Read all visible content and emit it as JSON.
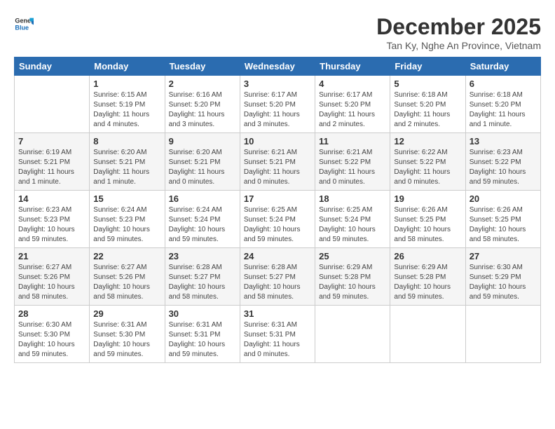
{
  "logo": {
    "line1": "General",
    "line2": "Blue"
  },
  "title": "December 2025",
  "subtitle": "Tan Ky, Nghe An Province, Vietnam",
  "weekdays": [
    "Sunday",
    "Monday",
    "Tuesday",
    "Wednesday",
    "Thursday",
    "Friday",
    "Saturday"
  ],
  "weeks": [
    [
      {
        "day": "",
        "info": ""
      },
      {
        "day": "1",
        "info": "Sunrise: 6:15 AM\nSunset: 5:19 PM\nDaylight: 11 hours\nand 4 minutes."
      },
      {
        "day": "2",
        "info": "Sunrise: 6:16 AM\nSunset: 5:20 PM\nDaylight: 11 hours\nand 3 minutes."
      },
      {
        "day": "3",
        "info": "Sunrise: 6:17 AM\nSunset: 5:20 PM\nDaylight: 11 hours\nand 3 minutes."
      },
      {
        "day": "4",
        "info": "Sunrise: 6:17 AM\nSunset: 5:20 PM\nDaylight: 11 hours\nand 2 minutes."
      },
      {
        "day": "5",
        "info": "Sunrise: 6:18 AM\nSunset: 5:20 PM\nDaylight: 11 hours\nand 2 minutes."
      },
      {
        "day": "6",
        "info": "Sunrise: 6:18 AM\nSunset: 5:20 PM\nDaylight: 11 hours\nand 1 minute."
      }
    ],
    [
      {
        "day": "7",
        "info": "Sunrise: 6:19 AM\nSunset: 5:21 PM\nDaylight: 11 hours\nand 1 minute."
      },
      {
        "day": "8",
        "info": "Sunrise: 6:20 AM\nSunset: 5:21 PM\nDaylight: 11 hours\nand 1 minute."
      },
      {
        "day": "9",
        "info": "Sunrise: 6:20 AM\nSunset: 5:21 PM\nDaylight: 11 hours\nand 0 minutes."
      },
      {
        "day": "10",
        "info": "Sunrise: 6:21 AM\nSunset: 5:21 PM\nDaylight: 11 hours\nand 0 minutes."
      },
      {
        "day": "11",
        "info": "Sunrise: 6:21 AM\nSunset: 5:22 PM\nDaylight: 11 hours\nand 0 minutes."
      },
      {
        "day": "12",
        "info": "Sunrise: 6:22 AM\nSunset: 5:22 PM\nDaylight: 11 hours\nand 0 minutes."
      },
      {
        "day": "13",
        "info": "Sunrise: 6:23 AM\nSunset: 5:22 PM\nDaylight: 10 hours\nand 59 minutes."
      }
    ],
    [
      {
        "day": "14",
        "info": "Sunrise: 6:23 AM\nSunset: 5:23 PM\nDaylight: 10 hours\nand 59 minutes."
      },
      {
        "day": "15",
        "info": "Sunrise: 6:24 AM\nSunset: 5:23 PM\nDaylight: 10 hours\nand 59 minutes."
      },
      {
        "day": "16",
        "info": "Sunrise: 6:24 AM\nSunset: 5:24 PM\nDaylight: 10 hours\nand 59 minutes."
      },
      {
        "day": "17",
        "info": "Sunrise: 6:25 AM\nSunset: 5:24 PM\nDaylight: 10 hours\nand 59 minutes."
      },
      {
        "day": "18",
        "info": "Sunrise: 6:25 AM\nSunset: 5:24 PM\nDaylight: 10 hours\nand 59 minutes."
      },
      {
        "day": "19",
        "info": "Sunrise: 6:26 AM\nSunset: 5:25 PM\nDaylight: 10 hours\nand 58 minutes."
      },
      {
        "day": "20",
        "info": "Sunrise: 6:26 AM\nSunset: 5:25 PM\nDaylight: 10 hours\nand 58 minutes."
      }
    ],
    [
      {
        "day": "21",
        "info": "Sunrise: 6:27 AM\nSunset: 5:26 PM\nDaylight: 10 hours\nand 58 minutes."
      },
      {
        "day": "22",
        "info": "Sunrise: 6:27 AM\nSunset: 5:26 PM\nDaylight: 10 hours\nand 58 minutes."
      },
      {
        "day": "23",
        "info": "Sunrise: 6:28 AM\nSunset: 5:27 PM\nDaylight: 10 hours\nand 58 minutes."
      },
      {
        "day": "24",
        "info": "Sunrise: 6:28 AM\nSunset: 5:27 PM\nDaylight: 10 hours\nand 58 minutes."
      },
      {
        "day": "25",
        "info": "Sunrise: 6:29 AM\nSunset: 5:28 PM\nDaylight: 10 hours\nand 59 minutes."
      },
      {
        "day": "26",
        "info": "Sunrise: 6:29 AM\nSunset: 5:28 PM\nDaylight: 10 hours\nand 59 minutes."
      },
      {
        "day": "27",
        "info": "Sunrise: 6:30 AM\nSunset: 5:29 PM\nDaylight: 10 hours\nand 59 minutes."
      }
    ],
    [
      {
        "day": "28",
        "info": "Sunrise: 6:30 AM\nSunset: 5:30 PM\nDaylight: 10 hours\nand 59 minutes."
      },
      {
        "day": "29",
        "info": "Sunrise: 6:31 AM\nSunset: 5:30 PM\nDaylight: 10 hours\nand 59 minutes."
      },
      {
        "day": "30",
        "info": "Sunrise: 6:31 AM\nSunset: 5:31 PM\nDaylight: 10 hours\nand 59 minutes."
      },
      {
        "day": "31",
        "info": "Sunrise: 6:31 AM\nSunset: 5:31 PM\nDaylight: 11 hours\nand 0 minutes."
      },
      {
        "day": "",
        "info": ""
      },
      {
        "day": "",
        "info": ""
      },
      {
        "day": "",
        "info": ""
      }
    ]
  ]
}
